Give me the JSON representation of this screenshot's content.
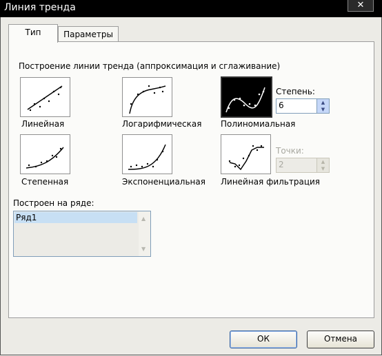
{
  "window": {
    "title": "Линия тренда",
    "close_glyph": "✕"
  },
  "tabs": [
    {
      "label": "Тип",
      "active": true
    },
    {
      "label": "Параметры",
      "active": false
    }
  ],
  "trend_group": {
    "legend": "Построение линии тренда (аппроксимация и сглаживание)",
    "types": [
      {
        "label": "Линейная",
        "icon": "linear-trend-icon"
      },
      {
        "label": "Логарифмическая",
        "icon": "logarithmic-trend-icon"
      },
      {
        "label": "Полиномиальная",
        "icon": "polynomial-trend-icon",
        "selected": true
      },
      {
        "label": "Степенная",
        "icon": "power-trend-icon"
      },
      {
        "label": "Экспоненциальная",
        "icon": "exponential-trend-icon"
      },
      {
        "label": "Линейная фильтрация",
        "icon": "moving-average-trend-icon"
      }
    ],
    "degree": {
      "label": "Степень:",
      "value": "6"
    },
    "period": {
      "label": "Точки:",
      "value": "2"
    }
  },
  "series_section": {
    "label": "Построен на ряде:",
    "items": [
      "Ряд1"
    ]
  },
  "buttons": {
    "ok": "ОК",
    "cancel": "Отмена"
  },
  "colors": {
    "titlebar": "#000000",
    "selected_thumb": "#000000",
    "list_selection": "#c7dff4"
  }
}
